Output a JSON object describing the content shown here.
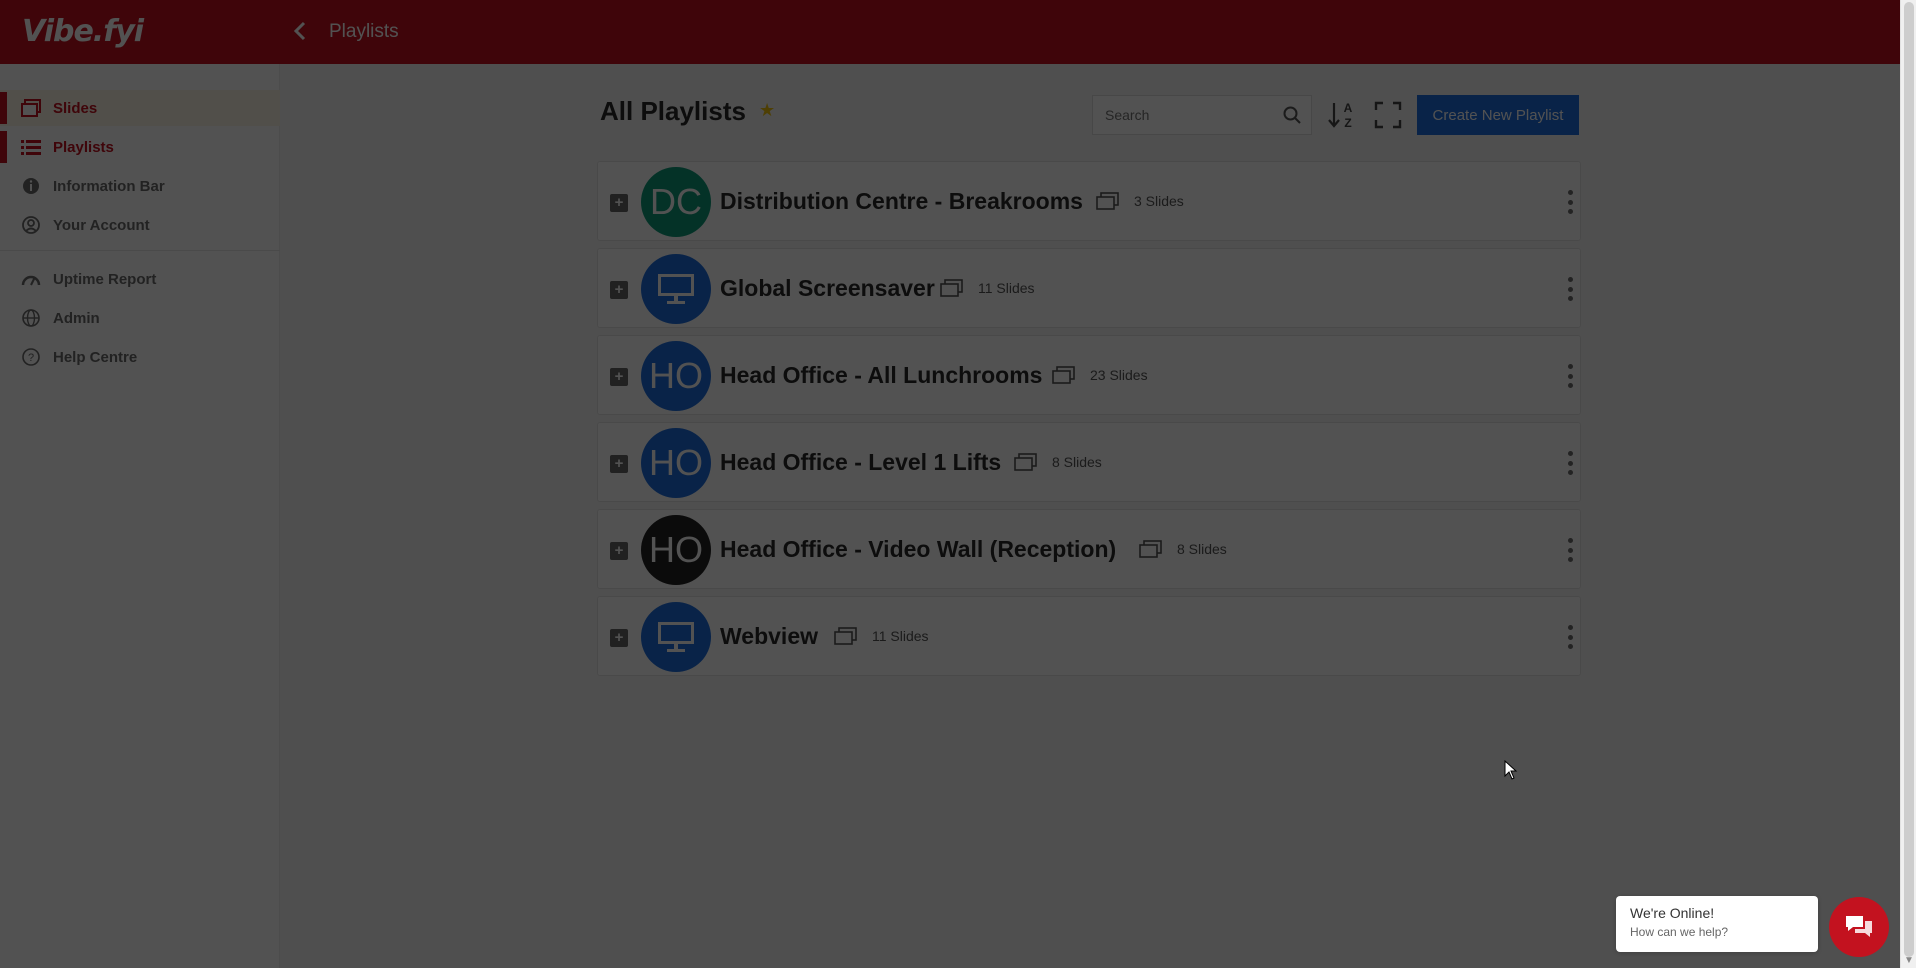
{
  "app": {
    "logo": "Vibe.fyi"
  },
  "header": {
    "breadcrumb": "Playlists"
  },
  "sidebar": {
    "items": [
      {
        "label": "Slides",
        "icon": "slides-icon",
        "active": true
      },
      {
        "label": "Playlists",
        "icon": "list-icon",
        "active": true
      },
      {
        "label": "Information Bar",
        "icon": "info-icon",
        "active": false
      },
      {
        "label": "Your Account",
        "icon": "account-icon",
        "active": false
      },
      {
        "label": "Uptime Report",
        "icon": "gauge-icon",
        "active": false
      },
      {
        "label": "Admin",
        "icon": "globe-icon",
        "active": false
      },
      {
        "label": "Help Centre",
        "icon": "help-icon",
        "active": false
      }
    ]
  },
  "main": {
    "title": "All Playlists",
    "search_placeholder": "Search",
    "create_label": "Create New Playlist",
    "playlists": [
      {
        "name": "Distribution Centre - Breakrooms",
        "initials": "DC",
        "avatar_color": "#0f9b7a",
        "count": "3 Slides"
      },
      {
        "name": "Global Screensaver",
        "initials": "",
        "avatar_color": "#1e6fe0",
        "count": "11 Slides"
      },
      {
        "name": "Head Office - All Lunchrooms",
        "initials": "HO",
        "avatar_color": "#1e6fe0",
        "count": "23 Slides"
      },
      {
        "name": "Head Office - Level 1 Lifts",
        "initials": "HO",
        "avatar_color": "#1e6fe0",
        "count": "8 Slides"
      },
      {
        "name": "Head Office - Video Wall (Reception)",
        "initials": "HO",
        "avatar_color": "#222222",
        "count": "8 Slides"
      },
      {
        "name": "Webview",
        "initials": "",
        "avatar_color": "#1e6fe0",
        "count": "11 Slides"
      }
    ]
  },
  "chat": {
    "title": "We're Online!",
    "subtitle": "How can we help?"
  },
  "colors": {
    "brand": "#c3121f",
    "primary": "#1e6fe0"
  }
}
